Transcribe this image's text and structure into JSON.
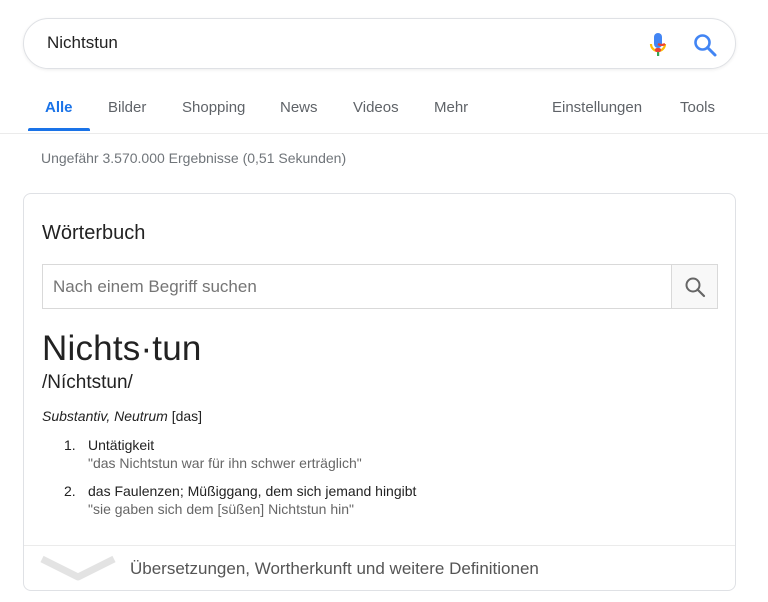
{
  "search": {
    "query": "Nichtstun",
    "mic_icon": "microphone-icon",
    "search_icon": "magnifier-icon",
    "accent_colors": [
      "#4285f4",
      "#ea4335",
      "#fbbc05",
      "#34a853"
    ]
  },
  "tabs": {
    "items": [
      {
        "label": "Alle",
        "active": true
      },
      {
        "label": "Bilder"
      },
      {
        "label": "Shopping"
      },
      {
        "label": "News"
      },
      {
        "label": "Videos"
      },
      {
        "label": "Mehr"
      }
    ],
    "settings": "Einstellungen",
    "tools": "Tools",
    "active_color": "#1a73e8"
  },
  "result_stats": "Ungefähr 3.570.000 Ergebnisse (0,51 Sekunden)",
  "dictionary": {
    "title": "Wörterbuch",
    "search_placeholder": "Nach einem Begriff suchen",
    "headword": "Nichts·tun",
    "phonetic": "/Níchtstun/",
    "pos_italic": "Substantiv, Neutrum",
    "pos_article": "[das]",
    "senses": [
      {
        "num": "1.",
        "definition": "Untätigkeit",
        "example": "\"das Nichtstun war für ihn schwer erträglich\""
      },
      {
        "num": "2.",
        "definition": "das Faulenzen; Müßiggang, dem sich jemand hingibt",
        "example": "\"sie gaben sich dem [süßen] Nichtstun hin\""
      }
    ],
    "more_label": "Übersetzungen, Wortherkunft und weitere Definitionen",
    "more_icon": "chevron-down-icon"
  }
}
